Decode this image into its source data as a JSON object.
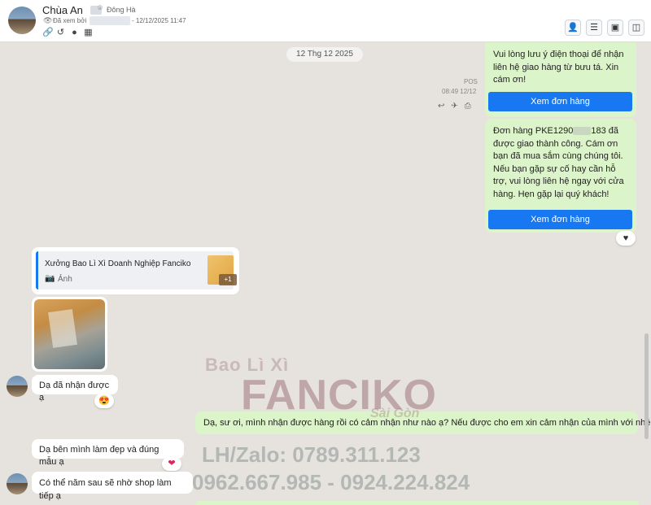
{
  "header": {
    "contact_name": "Chùa An",
    "location": "Đông Hà",
    "seen_by": "Đã xem bởi",
    "seen_time": "- 12/12/2025 11:47",
    "icons": [
      "link-icon",
      "history-icon",
      "person-icon",
      "calendar-icon"
    ],
    "buttons": [
      "add-user-icon",
      "checklist-icon",
      "media-icon",
      "panel-icon"
    ]
  },
  "date_separator": "12 Thg 12 2025",
  "messages": {
    "sent1": {
      "text": "Vui lòng lưu ý điện thoại để nhận liên hệ giao hàng từ bưu tá. Xin cám ơn!",
      "button": "Xem đơn hàng",
      "source": "POS",
      "time": "08:49 12/12"
    },
    "sent2": {
      "text_before": "Đơn hàng PKE1290",
      "text_after": "183 đã được giao thành công. Cám ơn bạn đã mua sắm cùng chúng tôi. Nếu bạn gặp sự cố hay cần hỗ trợ, vui lòng liên hệ ngay với cửa hàng. Hẹn gặp lại quý khách!",
      "button": "Xem đơn hàng",
      "reaction": "♥"
    },
    "card": {
      "title": "Xưởng Bao Lì Xì Doanh Nghiệp Fanciko",
      "subtitle": "Ảnh",
      "count": "+1"
    },
    "recv1": {
      "text": "Dạ đã nhận được ạ",
      "reaction": "😍"
    },
    "sent3": {
      "text": "Dạ, sư ơi, mình nhận được hàng rồi có cảm nhận như nào ạ? Nếu được cho em xin cảm nhận của mình với nhé ^^"
    },
    "recv2": {
      "text": "Dạ bên mình làm đẹp và đúng mẫu ạ",
      "reaction": "❤"
    },
    "recv3": {
      "text": "Có thể năm sau sẽ nhờ shop làm tiếp ạ"
    }
  },
  "watermark": {
    "line1": "Bao Lì Xì",
    "brand": "FANCIKO",
    "sub": "Sài Gòn",
    "contact": "LH/Zalo: 0789.311.123",
    "phones": "0962.667.985 - 0924.224.824"
  },
  "colors": {
    "sent_bubble": "#dcf4c9",
    "button_blue": "#1878f2",
    "background": "#e6e3df"
  }
}
